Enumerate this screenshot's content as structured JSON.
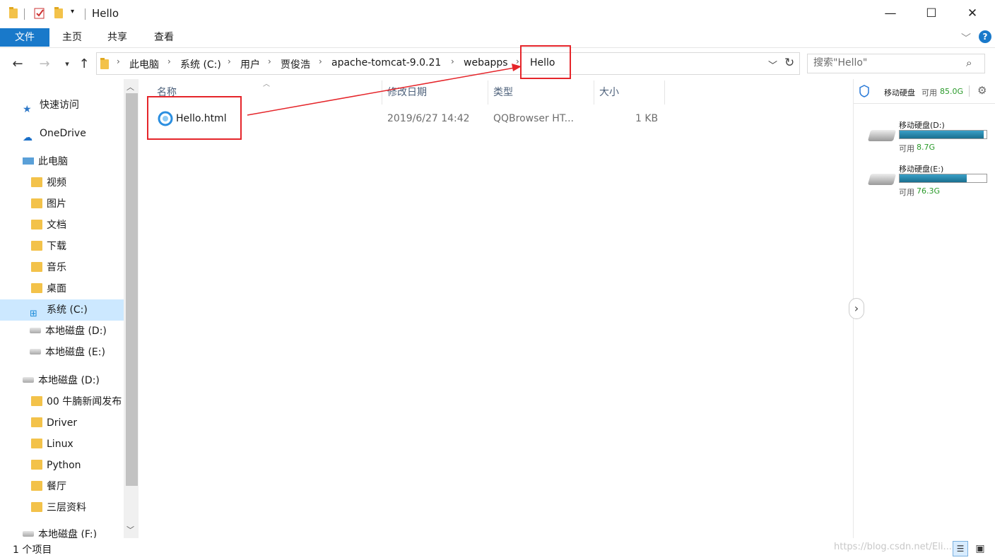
{
  "window": {
    "title": "Hello",
    "minimize": "—",
    "maximize": "☐",
    "close": "✕"
  },
  "ribbon": {
    "tabs": [
      "文件",
      "主页",
      "共享",
      "查看"
    ],
    "help": "?"
  },
  "address": {
    "crumbs": [
      "此电脑",
      "系统 (C:)",
      "用户",
      "贾俊浩",
      "apache-tomcat-9.0.21",
      "webapps",
      "Hello"
    ]
  },
  "search": {
    "placeholder": "搜索\"Hello\""
  },
  "nav": {
    "quick_access": "快速访问",
    "onedrive": "OneDrive",
    "this_pc": "此电脑",
    "items": [
      "视频",
      "图片",
      "文档",
      "下载",
      "音乐",
      "桌面",
      "系统 (C:)",
      "本地磁盘 (D:)",
      "本地磁盘 (E:)"
    ],
    "disk_d": "本地磁盘 (D:)",
    "disk_d_folders": [
      "00 牛腩新闻发布",
      "Driver",
      "Linux",
      "Python",
      "餐厅",
      "三层资料"
    ],
    "disk_f": "本地磁盘 (F:)"
  },
  "columns": {
    "name": "名称",
    "modified": "修改日期",
    "type": "类型",
    "size": "大小"
  },
  "files": [
    {
      "name": "Hello.html",
      "modified": "2019/6/27 14:42",
      "type": "QQBrowser HT...",
      "size": "1 KB"
    }
  ],
  "right_pane": {
    "header_label": "移动硬盘",
    "header_avail_label": "可用",
    "header_avail": "85.0G",
    "drives": [
      {
        "name": "移动硬盘(D:)",
        "avail_label": "可用",
        "avail": "8.7G",
        "used_fraction": 0.97
      },
      {
        "name": "移动硬盘(E:)",
        "avail_label": "可用",
        "avail": "76.3G",
        "used_fraction": 0.77
      }
    ]
  },
  "status": {
    "count": "1 个项目"
  },
  "watermark": "https://blog.csdn.net/Eli..."
}
